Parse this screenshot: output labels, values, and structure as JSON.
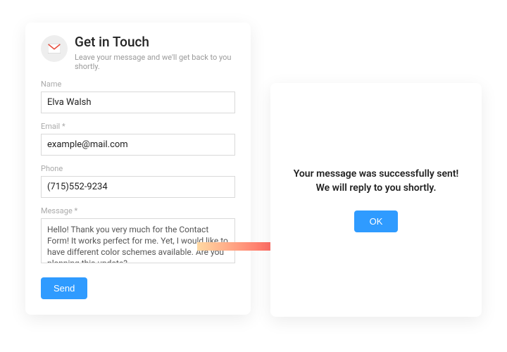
{
  "form": {
    "title": "Get in Touch",
    "subtitle": "Leave your message and we'll get back to you shortly.",
    "name_label": "Name",
    "name_value": "Elva Walsh",
    "email_label": "Email *",
    "email_value": "example@mail.com",
    "phone_label": "Phone",
    "phone_value": "(715)552-9234",
    "message_label": "Message *",
    "message_value": "Hello! Thank you very much for the Contact Form! It works perfect for me. Yet, I would like to have different color schemes available. Are you planning this update?",
    "send_label": "Send"
  },
  "confirm": {
    "message": "Your message was successfully sent! We will reply to you shortly.",
    "ok_label": "OK"
  }
}
